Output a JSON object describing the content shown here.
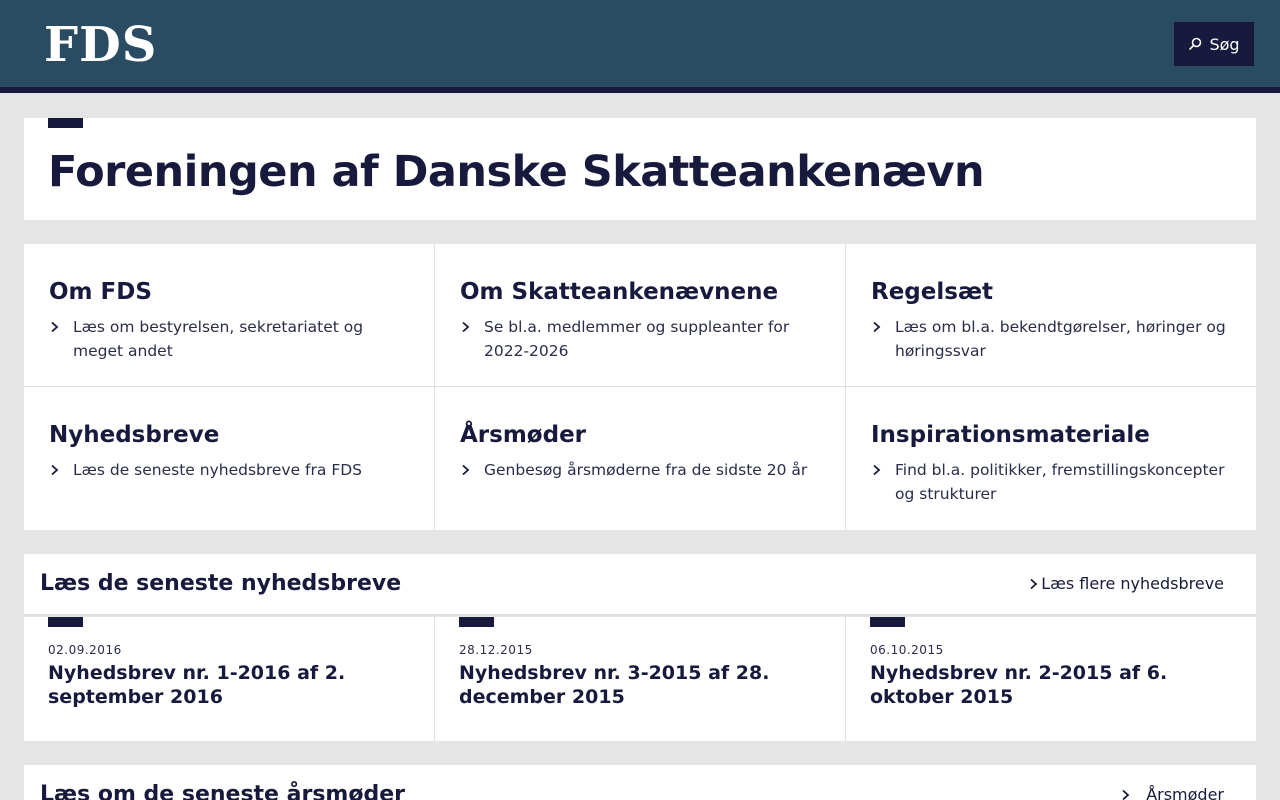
{
  "header": {
    "logo": "FDS",
    "search_label": "Søg"
  },
  "page_title": "Foreningen af Danske Skatteankenævn",
  "sections": [
    {
      "title": "Om FDS",
      "description": "Læs om bestyrelsen, sekretariatet og meget andet"
    },
    {
      "title": "Om Skatteankenævnene",
      "description": "Se bl.a. medlemmer og suppleanter for 2022-2026"
    },
    {
      "title": "Regelsæt",
      "description": "Læs om bl.a. bekendtgørelser, høringer og høringssvar"
    },
    {
      "title": "Nyhedsbreve",
      "description": "Læs de seneste nyhedsbreve fra FDS"
    },
    {
      "title": "Årsmøder",
      "description": "Genbesøg årsmøderne fra de sidste 20 år"
    },
    {
      "title": "Inspirationsmateriale",
      "description": "Find bl.a. politikker, fremstillingskoncepter og strukturer"
    }
  ],
  "newsletters": {
    "heading": "Læs de seneste nyhedsbreve",
    "more_link": "Læs flere nyhedsbreve",
    "items": [
      {
        "date": "02.09.2016",
        "title": "Nyhedsbrev nr. 1-2016 af 2. september 2016"
      },
      {
        "date": "28.12.2015",
        "title": "Nyhedsbrev nr. 3-2015 af 28. december 2015"
      },
      {
        "date": "06.10.2015",
        "title": "Nyhedsbrev nr. 2-2015 af 6. oktober 2015"
      }
    ]
  },
  "meetings": {
    "heading": "Læs om de seneste årsmøder",
    "more_link": "Årsmøder"
  }
}
